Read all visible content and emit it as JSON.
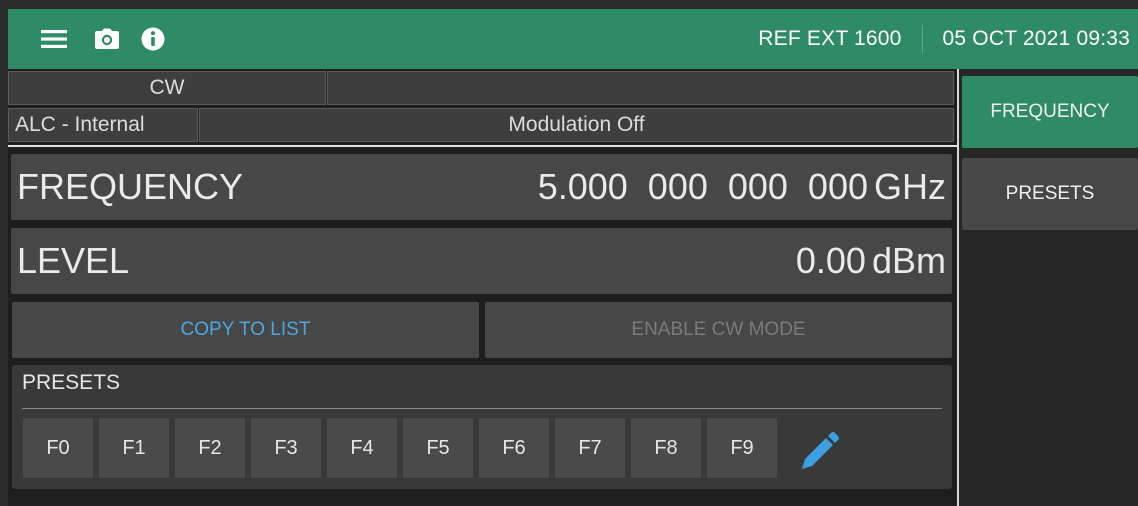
{
  "topbar": {
    "icons": [
      "menu-icon",
      "camera-icon",
      "info-icon"
    ],
    "ref_text": "REF EXT 1600",
    "datetime": "05 OCT 2021 09:33",
    "bg_color": "#2f8a66"
  },
  "status": {
    "mode": "CW",
    "mode_detail": "",
    "alc": "ALC - Internal",
    "modulation": "Modulation Off"
  },
  "frequency": {
    "label": "FREQUENCY",
    "value": "5.000  000  000  000",
    "unit": "GHz"
  },
  "level": {
    "label": "LEVEL",
    "value": "0.00",
    "unit": "dBm"
  },
  "actions": {
    "copy_label": "COPY TO LIST",
    "enable_label": "ENABLE CW MODE",
    "copy_color": "#4aa7e0",
    "enable_color": "#7b7b7b"
  },
  "presets": {
    "title": "PRESETS",
    "keys": [
      "F0",
      "F1",
      "F2",
      "F3",
      "F4",
      "F5",
      "F6",
      "F7",
      "F8",
      "F9"
    ],
    "edit_icon": "pencil-icon"
  },
  "side_menu": {
    "items": [
      {
        "label": "FREQUENCY",
        "active": true
      },
      {
        "label": "PRESETS",
        "active": false
      }
    ],
    "accent": "#2f8a66"
  }
}
